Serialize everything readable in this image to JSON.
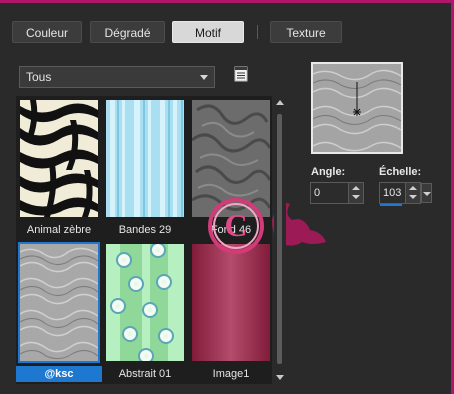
{
  "tabs": [
    {
      "label": "Couleur"
    },
    {
      "label": "Dégradé"
    },
    {
      "label": "Motif"
    },
    {
      "label": "Texture"
    }
  ],
  "active_tab": "Motif",
  "category": {
    "selected": "Tous"
  },
  "patterns": [
    {
      "label": "Animal zèbre"
    },
    {
      "label": "Bandes 29"
    },
    {
      "label": "Fond 46"
    },
    {
      "label": "@ksc"
    },
    {
      "label": "Abstrait 01"
    },
    {
      "label": "Image1"
    }
  ],
  "selected_pattern": "@ksc",
  "controls": {
    "angle": {
      "label": "Angle:",
      "value": "0"
    },
    "scale": {
      "label": "Échelle:",
      "value": "103"
    }
  },
  "colors": {
    "accent": "#1e78d0",
    "frame": "#b0166a",
    "background": "#2a2a2a"
  }
}
